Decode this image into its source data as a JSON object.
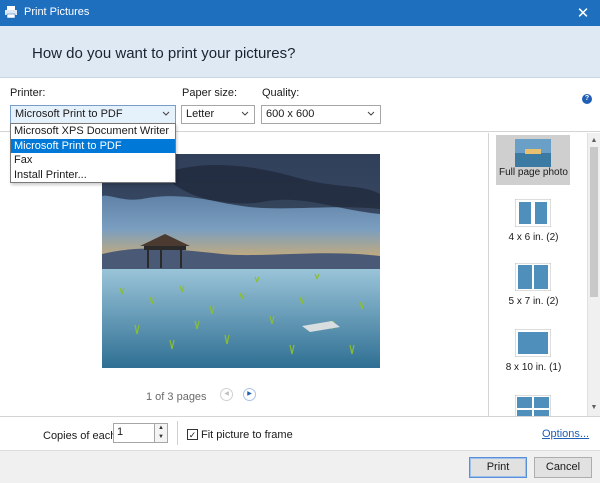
{
  "window": {
    "title": "Print Pictures",
    "close_glyph": "✕"
  },
  "header": {
    "heading": "How do you want to print your pictures?"
  },
  "controls": {
    "printer_label": "Printer:",
    "printer_value": "Microsoft Print to PDF",
    "paper_label": "Paper size:",
    "paper_value": "Letter",
    "quality_label": "Quality:",
    "quality_value": "600 x 600",
    "help_glyph": "?"
  },
  "printer_dropdown": {
    "options": [
      "Microsoft XPS Document Writer",
      "Microsoft Print to PDF",
      "Fax",
      "Install Printer..."
    ],
    "selected_index": 1
  },
  "preview": {
    "pages_text": "1 of 3 pages"
  },
  "layouts": [
    {
      "label": "Full page photo",
      "selected": true
    },
    {
      "label": "4 x 6 in. (2)",
      "selected": false
    },
    {
      "label": "5 x 7 in. (2)",
      "selected": false
    },
    {
      "label": "8 x 10 in. (1)",
      "selected": false
    },
    {
      "label": "",
      "selected": false
    }
  ],
  "bottom": {
    "copies_label": "Copies of each",
    "copies_value": "1",
    "fit_label": "Fit picture to frame",
    "fit_checked": true,
    "options_link": "Options..."
  },
  "footer": {
    "print_label": "Print",
    "cancel_label": "Cancel"
  },
  "colors": {
    "titlebar": "#1f6fbf",
    "header_band": "#dfe9f4",
    "selection": "#0078d7",
    "link": "#1f5fb5"
  }
}
